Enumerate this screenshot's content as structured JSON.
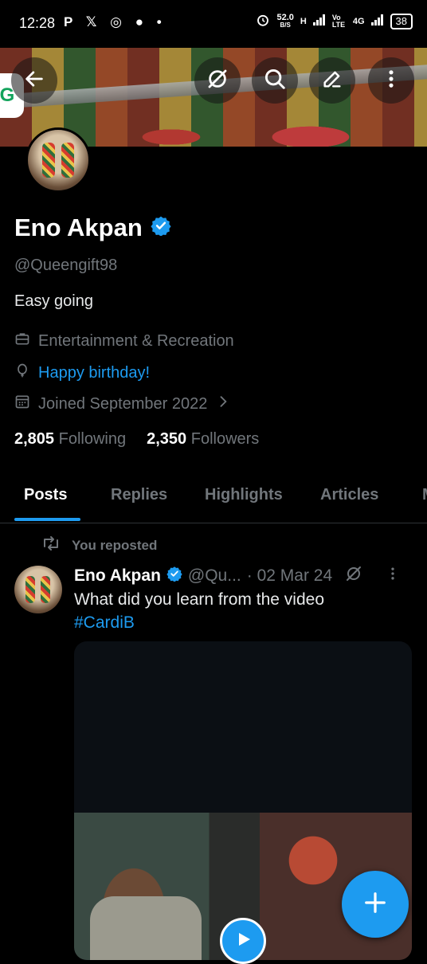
{
  "status_bar": {
    "time": "12:28",
    "notification_icons": "P 𝕏 ◎ ● •",
    "net_speed": "52.0",
    "net_unit": "B/S",
    "network_h": "H",
    "network_volte": "Vo LTE",
    "network_4g": "4G",
    "battery": "38"
  },
  "header": {
    "back_icon": "arrow-left-icon",
    "grok_icon": "grok-icon",
    "search_icon": "search-icon",
    "edit_icon": "pencil-icon",
    "more_icon": "more-vertical-icon",
    "badge_letter": "G"
  },
  "profile": {
    "name": "Eno Akpan",
    "handle": "@Queengift98",
    "bio": "Easy going",
    "category": "Entertainment & Recreation",
    "birthday": "Happy birthday!",
    "joined": "Joined September 2022",
    "following_count": "2,805",
    "following_label": "Following",
    "followers_count": "2,350",
    "followers_label": "Followers"
  },
  "tabs": [
    "Posts",
    "Replies",
    "Highlights",
    "Articles"
  ],
  "post": {
    "repost_label": "You reposted",
    "author": "Eno Akpan",
    "handle": "@Qu...",
    "date": "· 02 Mar 24",
    "text": "What did you learn from the video",
    "hashtag": "#CardiB"
  },
  "colors": {
    "accent": "#1d9bf0",
    "background": "#000000",
    "muted": "#71767b"
  }
}
